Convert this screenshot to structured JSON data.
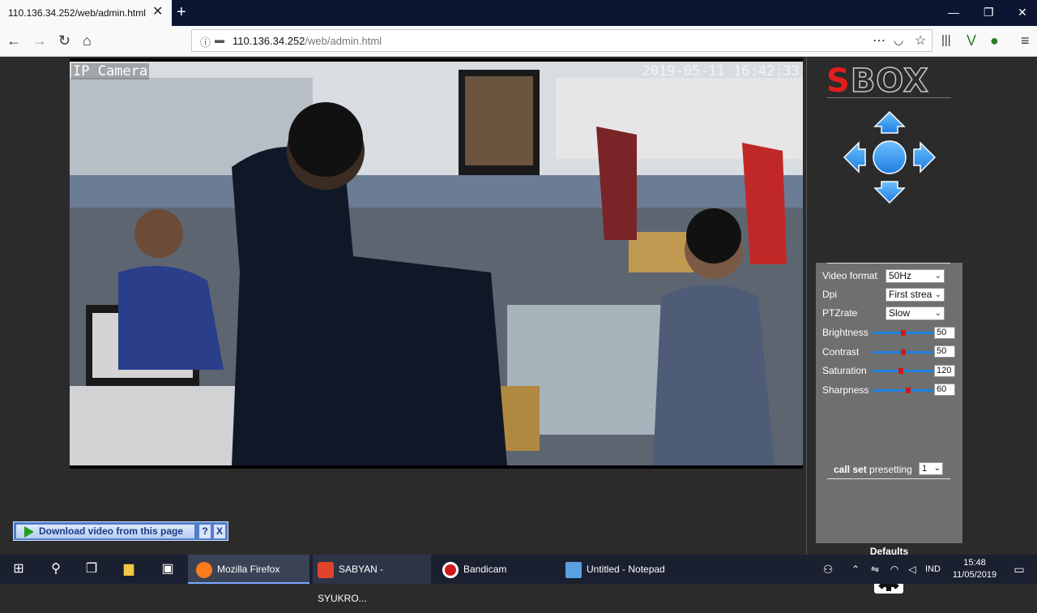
{
  "browser": {
    "tab_title": "110.136.34.252/web/admin.html",
    "url_host": "110.136.34.252",
    "url_path": "/web/admin.html"
  },
  "camera": {
    "label": "IP Camera",
    "timestamp": "2019-05-11  16:42:33"
  },
  "controls": {
    "logo_first": "S",
    "logo_rest": "BOX",
    "video_format": {
      "label": "Video format",
      "value": "50Hz"
    },
    "dpi": {
      "label": "Dpi",
      "value": "First strea"
    },
    "ptz_rate": {
      "label": "PTZrate",
      "value": "Slow"
    },
    "sliders": [
      {
        "label": "Brightness",
        "value": "50",
        "level": 0.5
      },
      {
        "label": "Contrast",
        "value": "50",
        "level": 0.5
      },
      {
        "label": "Saturation",
        "value": "120",
        "level": 0.47
      },
      {
        "label": "Sharpness",
        "value": "60",
        "level": 0.6
      }
    ],
    "call_set_bold": "call set",
    "presetting_label": "presetting",
    "presetting_value": "1",
    "defaults_label": "Defaults"
  },
  "download_bar": {
    "label": "Download video from this page",
    "help": "?",
    "close": "X"
  },
  "taskbar": {
    "apps": [
      {
        "label": "Mozilla Firefox",
        "color": "#ff7a1a"
      },
      {
        "label": "SABYAN - SYUKRO...",
        "color": "#e0442a"
      },
      {
        "label": "Bandicam",
        "color": "#d01818"
      },
      {
        "label": "Untitled - Notepad",
        "color": "#5aa0e0"
      }
    ],
    "lang": "IND",
    "time": "15:48",
    "date": "11/05/2019"
  },
  "colors": {
    "accent_blue": "#1e90ff",
    "logo_red": "#e11d1d"
  }
}
